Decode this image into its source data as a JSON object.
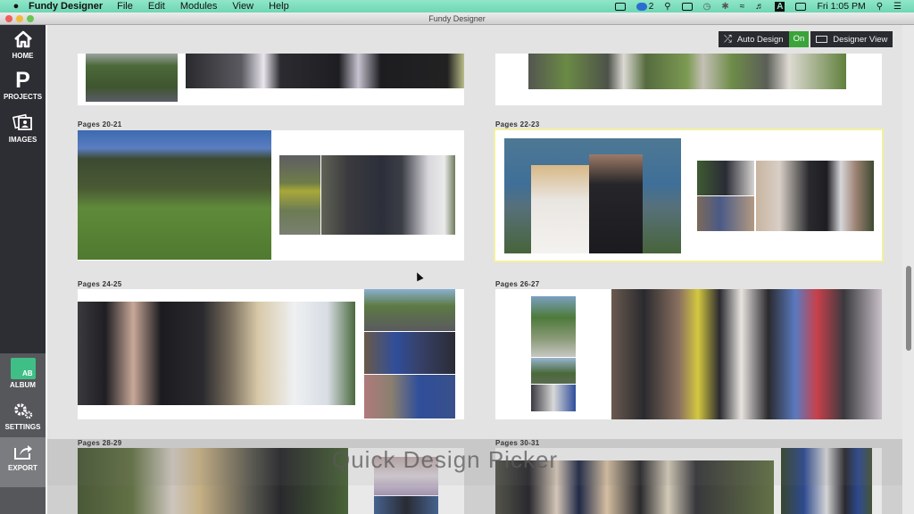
{
  "menubar": {
    "apple_icon": "apple-icon",
    "app_name": "Fundy Designer",
    "menus": [
      "File",
      "Edit",
      "Modules",
      "View",
      "Help"
    ],
    "status": {
      "cloud_badge": "2",
      "clock": "Fri 1:05 PM",
      "input_source": "A"
    }
  },
  "window": {
    "title": "Fundy Designer"
  },
  "sidebar": {
    "items": [
      {
        "label": "HOME",
        "icon": "home-icon"
      },
      {
        "label": "PROJECTS",
        "icon": "projects-p-icon",
        "glyph": "P"
      },
      {
        "label": "IMAGES",
        "icon": "images-icon"
      },
      {
        "label": "ALBUM",
        "icon": "album-icon",
        "glyph": "AB"
      },
      {
        "label": "SETTINGS",
        "icon": "gear-icon"
      },
      {
        "label": "EXPORT",
        "icon": "export-icon"
      }
    ]
  },
  "toolbar": {
    "auto_design_label": "Auto Design",
    "auto_design_state": "On",
    "designer_view_label": "Designer View",
    "accent_on": "#3aa43a"
  },
  "spreads": [
    {
      "label": "",
      "partial": true,
      "position": "top-left"
    },
    {
      "label": "",
      "partial": true,
      "position": "top-right"
    },
    {
      "label": "Pages 20-21",
      "selected": false
    },
    {
      "label": "Pages 22-23",
      "selected": true
    },
    {
      "label": "Pages 24-25",
      "selected": false
    },
    {
      "label": "Pages 26-27",
      "selected": false
    },
    {
      "label": "Pages 28-29",
      "selected": false
    },
    {
      "label": "Pages 30-31",
      "selected": false
    }
  ],
  "overlay": {
    "text": "Quick Design Picker"
  },
  "colors": {
    "sidebar_bg": "#2d2e34",
    "menubar_bg": "#7fdfbe",
    "album_green": "#3fbf86",
    "selected_outline": "#f2f0a0"
  }
}
